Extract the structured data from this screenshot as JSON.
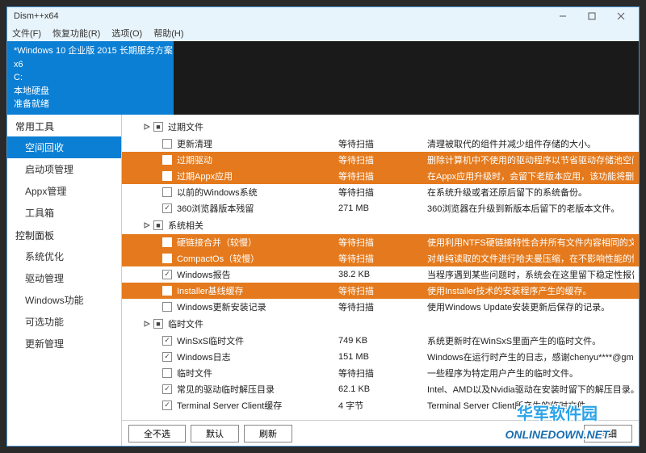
{
  "window": {
    "title": "Dism++x64"
  },
  "menu": {
    "file": "文件(F)",
    "recovery": "恢复功能(R)",
    "options": "选项(O)",
    "help": "帮助(H)"
  },
  "info": {
    "line1": "*Windows 10 企业版 2015 长期服务方案 x6",
    "line2": "C:",
    "line3": "本地硬盘",
    "line4": "准备就绪"
  },
  "sidebar": {
    "group1": "常用工具",
    "items1": [
      "空间回收",
      "启动项管理",
      "Appx管理",
      "工具箱"
    ],
    "group2": "控制面板",
    "items2": [
      "系统优化",
      "驱动管理",
      "Windows功能",
      "可选功能",
      "更新管理"
    ]
  },
  "cats": [
    {
      "label": "过期文件",
      "rows": [
        {
          "hl": false,
          "ck": false,
          "name": "更新清理",
          "size": "等待扫描",
          "desc": "清理被取代的组件并减少组件存储的大小。"
        },
        {
          "hl": true,
          "ck": false,
          "name": "过期驱动",
          "size": "等待扫描",
          "desc": "删除计算机中不使用的驱动程序以节省驱动存储池空间。"
        },
        {
          "hl": true,
          "ck": false,
          "name": "过期Appx应用",
          "size": "等待扫描",
          "desc": "在Appx应用升级时，会留下老版本应用，该功能将删除那些不使用的"
        },
        {
          "hl": false,
          "ck": false,
          "name": "以前的Windows系统",
          "size": "等待扫描",
          "desc": "在系统升级或者还原后留下的系统备份。"
        },
        {
          "hl": false,
          "ck": true,
          "name": "360浏览器版本残留",
          "size": "271 MB",
          "desc": "360浏览器在升级到新版本后留下的老版本文件。"
        }
      ]
    },
    {
      "label": "系统相关",
      "rows": [
        {
          "hl": true,
          "ck": false,
          "name": "硬链接合并（较慢）",
          "size": "等待扫描",
          "desc": "使用利用NTFS硬链接特性合并所有文件内容相同的文件。"
        },
        {
          "hl": true,
          "ck": false,
          "name": "CompactOs（较慢）",
          "size": "等待扫描",
          "desc": "对单纯读取的文件进行哈夫曼压缩，在不影响性能的情况下，显著减"
        },
        {
          "hl": false,
          "ck": true,
          "name": "Windows报告",
          "size": "38.2 KB",
          "desc": "当程序遇到某些问题时，系统会在这里留下稳定性报告。建议你定期"
        },
        {
          "hl": true,
          "ck": false,
          "name": "Installer基线缓存",
          "size": "等待扫描",
          "desc": "使用Installer技术的安装程序产生的缓存。"
        },
        {
          "hl": false,
          "ck": false,
          "name": "Windows更新安装记录",
          "size": "等待扫描",
          "desc": "使用Windows Update安装更新后保存的记录。"
        }
      ]
    },
    {
      "label": "临时文件",
      "rows": [
        {
          "hl": false,
          "ck": true,
          "name": "WinSxS临时文件",
          "size": "749 KB",
          "desc": "系统更新时在WinSxS里面产生的临时文件。"
        },
        {
          "hl": false,
          "ck": true,
          "name": "Windows日志",
          "size": "151 MB",
          "desc": "Windows在运行时产生的日志，感谢chenyu****@gmail.com、Yuk"
        },
        {
          "hl": false,
          "ck": false,
          "name": "临时文件",
          "size": "等待扫描",
          "desc": "一些程序为特定用户产生的临时文件。"
        },
        {
          "hl": false,
          "ck": true,
          "name": "常见的驱动临时解压目录",
          "size": "62.1 KB",
          "desc": "Intel、AMD以及Nvidia驱动在安装时留下的解压目录。"
        },
        {
          "hl": false,
          "ck": true,
          "name": "Terminal Server Client缓存",
          "size": "4 字节",
          "desc": "Terminal Server Client所产生的临时文件。"
        }
      ]
    }
  ],
  "buttons": {
    "none": "全不选",
    "default": "默认",
    "refresh": "刷新",
    "detail": "详细"
  },
  "watermark": {
    "line1": "华军软件园",
    "line2": "ONLINEDOWN.NET"
  }
}
